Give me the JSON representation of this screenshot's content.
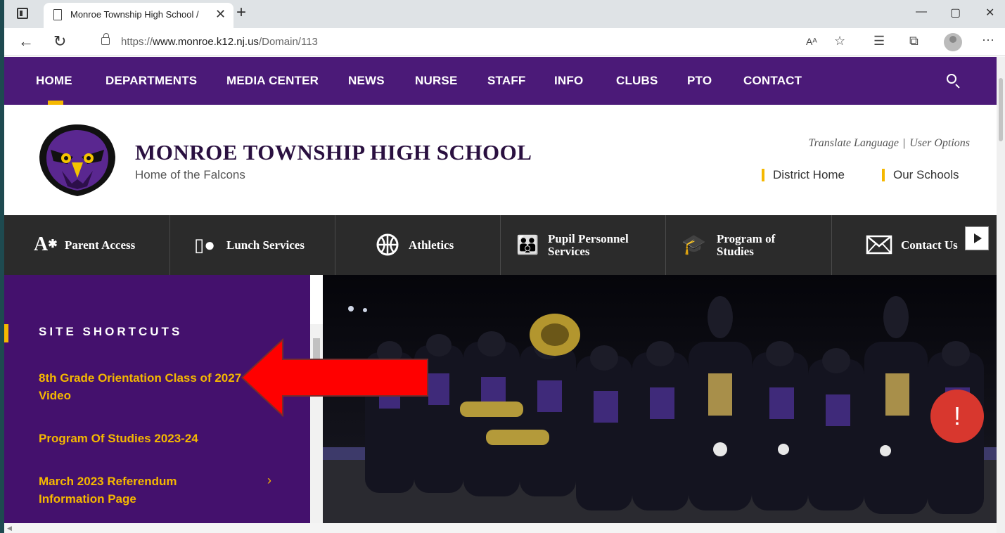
{
  "browser": {
    "tab_title": "Monroe Township High School /",
    "tab_close": "✕",
    "new_tab": "+",
    "window_controls": [
      "—",
      "▢",
      "✕"
    ],
    "url": {
      "scheme": "https://",
      "host": "www.monroe.k12.nj.us",
      "path": "/Domain/113"
    },
    "toolbar_icons": [
      "read-aloud-icon",
      "favorite-add-icon",
      "favorites-icon",
      "collections-icon",
      "profile-icon",
      "more-icon"
    ],
    "read_aloud": "Aᴬ",
    "more": "···"
  },
  "site": {
    "nav": {
      "items": [
        "HOME",
        "DEPARTMENTS",
        "MEDIA CENTER",
        "NEWS",
        "NURSE",
        "STAFF",
        "INFO",
        "CLUBS",
        "PTO",
        "CONTACT"
      ],
      "active": "HOME"
    },
    "header": {
      "school_name": "MONROE TOWNSHIP HIGH SCHOOL",
      "tagline": "Home of the Falcons",
      "translate": "Translate Language",
      "separator": "|",
      "user_options": "User Options",
      "district_home": "District Home",
      "our_schools": "Our Schools"
    },
    "quick_links": [
      {
        "label": "Parent Access",
        "icon": "parent-access-icon"
      },
      {
        "label": "Lunch Services",
        "icon": "lunch-icon"
      },
      {
        "label": "Athletics",
        "icon": "basketball-icon"
      },
      {
        "label_line1": "Pupil Personnel",
        "label_line2": "Services",
        "icon": "people-icon"
      },
      {
        "label_line1": "Program of",
        "label_line2": "Studies",
        "icon": "graduation-cap-icon"
      },
      {
        "label": "Contact Us",
        "icon": "envelope-icon"
      }
    ],
    "shortcuts": {
      "title": "SITE SHORTCUTS",
      "items": [
        {
          "line1": "8th Grade Orientation Class of 2027",
          "line2": "Video",
          "chevron": "›"
        },
        {
          "line1": "Program Of Studies 2023-24",
          "line2": ""
        },
        {
          "line1": "March 2023 Referendum",
          "line2": "Information Page",
          "chevron": "›"
        }
      ]
    },
    "alert": "!"
  },
  "colors": {
    "purple": "#4b1a78",
    "gold": "#f5b800",
    "dark_bar": "#2b2b2b",
    "alert_red": "#d8372e",
    "annotation_arrow": "#ff0000"
  }
}
